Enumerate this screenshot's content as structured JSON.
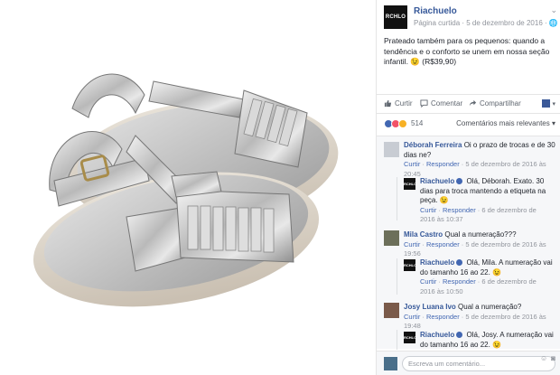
{
  "post": {
    "page_name": "Riachuelo",
    "logo_text": "RCHLO",
    "meta": "Página curtida · 5 de dezembro de 2016 · 🌐",
    "text": "Prateado também para os pequenos: quando a tendência e o conforto se unem em nossa seção infantil. 😉 (R$39,90)"
  },
  "actions": {
    "like": "Curtir",
    "comment": "Comentar",
    "share": "Compartilhar"
  },
  "reactions": {
    "count": "514",
    "sort_label": "Comentários mais relevantes ▾"
  },
  "comments": [
    {
      "name": "Déborah Ferreira",
      "text": "Oi o prazo de trocas e de 30 dias ne?",
      "like": "Curtir",
      "reply": "Responder",
      "time_a": "5 de dezembro de 2016 às",
      "time_b": "20:45"
    },
    {
      "name": "Riachuelo",
      "text": "Olá, Déborah. Exato. 30 dias para troca mantendo a etiqueta na peça. 😉",
      "like": "Curtir",
      "reply": "Responder",
      "time_a": "6 de dezembro de",
      "time_b": "2016 às 10:37"
    },
    {
      "name": "Mila Castro",
      "text": "Qual a numeração???",
      "like": "Curtir",
      "reply": "Responder",
      "time_a": "5 de dezembro de 2016 às",
      "time_b": "19:56"
    },
    {
      "name": "Riachuelo",
      "text": "Olá, Mila. A numeração vai do tamanho 16 ao 22. 😉",
      "like": "Curtir",
      "reply": "Responder",
      "time_a": "6 de dezembro de",
      "time_b": "2016 às 10:50"
    },
    {
      "name": "Josy Luana Ivo",
      "text": "Qual a numeração?",
      "like": "Curtir",
      "reply": "Responder",
      "time_a": "5 de dezembro de 2016 às",
      "time_b": "19:48"
    },
    {
      "name": "Riachuelo",
      "text": "Olá, Josy. A numeração vai do tamanho 16 ao 22. 😉",
      "like": "Curtir",
      "reply": "Responder",
      "time_a": "",
      "time_b": ""
    }
  ],
  "compose": {
    "placeholder": "Escreva um comentário..."
  },
  "colors": {
    "link": "#365899",
    "accent": "#4267b2",
    "muted": "#90949c"
  }
}
